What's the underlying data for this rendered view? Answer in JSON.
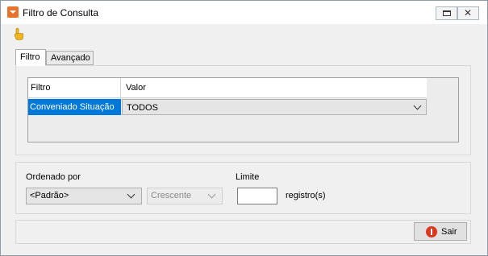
{
  "window": {
    "title": "Filtro de Consulta",
    "icons": {
      "app": "dropdown-arrow-app-icon",
      "restore": "restore-icon",
      "close": "close-icon",
      "toolbar": "pointing-hand-icon"
    },
    "close_glyph": "✕"
  },
  "tabs": [
    {
      "label": "Filtro",
      "selected": true
    },
    {
      "label": "Avançado",
      "selected": false
    }
  ],
  "filter_grid": {
    "columns": [
      "Filtro",
      "Valor"
    ],
    "rows": [
      {
        "filtro": "Conveniado Situação",
        "valor": "TODOS",
        "selected": true
      }
    ]
  },
  "sorting": {
    "label": "Ordenado por",
    "field_selected": "<Padrão>",
    "direction_selected": "Crescente",
    "direction_enabled": false
  },
  "limit": {
    "label": "Limite",
    "value": "",
    "unit_label": "registro(s)"
  },
  "footer": {
    "exit_label": "Sair",
    "exit_icon": "stop-icon"
  },
  "colors": {
    "selection": "#0078d7",
    "app_icon": "#e8732c",
    "exit_icon": "#d9381e"
  }
}
